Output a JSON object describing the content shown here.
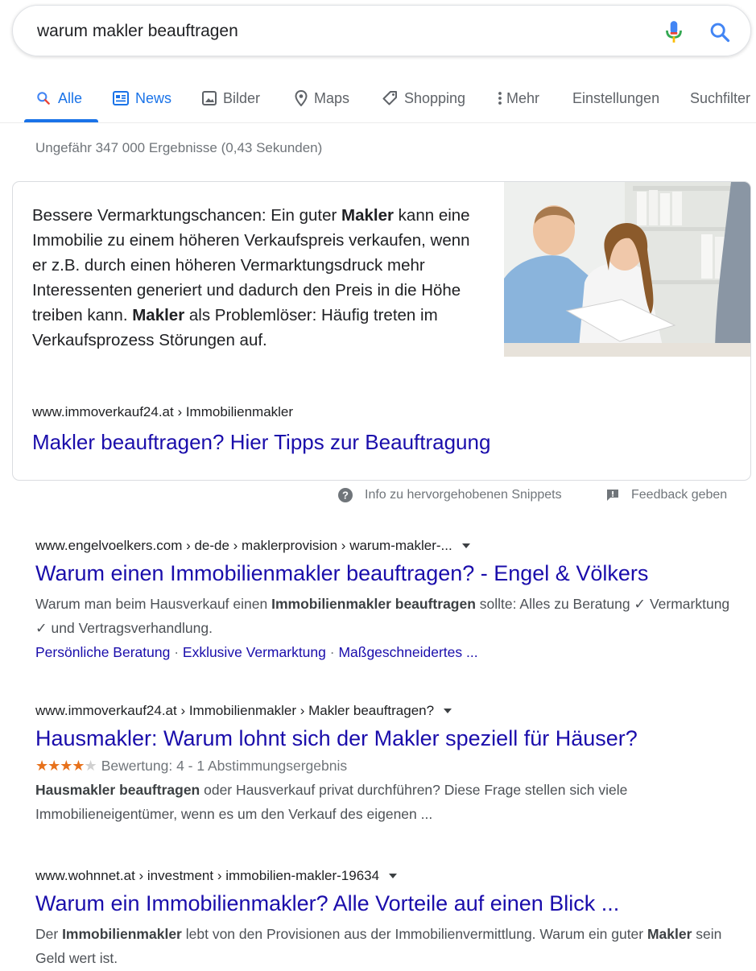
{
  "search": {
    "query": "warum makler beauftragen"
  },
  "tabs": [
    {
      "label": "Alle",
      "active": true
    },
    {
      "label": "News"
    },
    {
      "label": "Bilder"
    },
    {
      "label": "Maps"
    },
    {
      "label": "Shopping"
    },
    {
      "label": "Mehr"
    },
    {
      "label": "Einstellungen"
    },
    {
      "label": "Suchfilter"
    }
  ],
  "result_stats": "Ungefähr 347 000 Ergebnisse (0,43 Sekunden)",
  "featured_snippet": {
    "text_parts": [
      "Bessere Vermarktungschancen: Ein guter ",
      "Makler",
      " kann eine Immobilie zu einem höheren Verkaufspreis verkaufen, wenn er z.B. durch einen höheren Vermarktungsdruck mehr Interessenten generiert und dadurch den Preis in die Höhe treiben kann. ",
      "Makler",
      " als Problemlöser: Häufig treten im Verkaufsprozess Störungen auf."
    ],
    "cite": "www.immoverkauf24.at › Immobilienmakler",
    "title": "Makler beauftragen? Hier Tipps zur Beauftragung",
    "info_label": "Info zu hervorgehobenen Snippets",
    "feedback_label": "Feedback geben"
  },
  "results": [
    {
      "cite": "www.engelvoelkers.com › de-de › maklerprovision › warum-makler-...",
      "title": "Warum einen Immobilienmakler beauftragen? - Engel & Völkers",
      "snippet_parts": [
        "Warum man beim Hausverkauf einen ",
        "Immobilienmakler beauftragen",
        " sollte: Alles zu Beratung ✓ Vermarktung ✓ und Vertragsverhandlung."
      ],
      "sitelinks": [
        "Persönliche Beratung",
        "Exklusive Vermarktung",
        "Maßgeschneidertes ..."
      ],
      "sitelink_separator": " · "
    },
    {
      "cite": "www.immoverkauf24.at › Immobilienmakler › Makler beauftragen?",
      "title": "Hausmakler: Warum lohnt sich der Makler speziell für Häuser?",
      "rating_value": 4,
      "rating_max": 5,
      "rating_text": "Bewertung: 4 - 1 Abstimmungsergebnis",
      "snippet_parts": [
        "",
        "Hausmakler beauftragen",
        " oder Hausverkauf privat durchführen? Diese Frage stellen sich viele Immobilieneigentümer, wenn es um den Verkauf des eigenen ..."
      ]
    },
    {
      "cite": "www.wohnnet.at › investment › immobilien-makler-19634",
      "title": "Warum ein Immobilienmakler? Alle Vorteile auf einen Blick ...",
      "snippet_parts": [
        "Der ",
        "Immobilienmakler",
        " lebt von den Provisionen aus der Immobilienvermittlung. Warum ein guter ",
        "Makler",
        " sein Geld wert ist."
      ]
    }
  ],
  "colors": {
    "link": "#1a0dab",
    "accent": "#1a73e8",
    "star": "#e7711b"
  }
}
